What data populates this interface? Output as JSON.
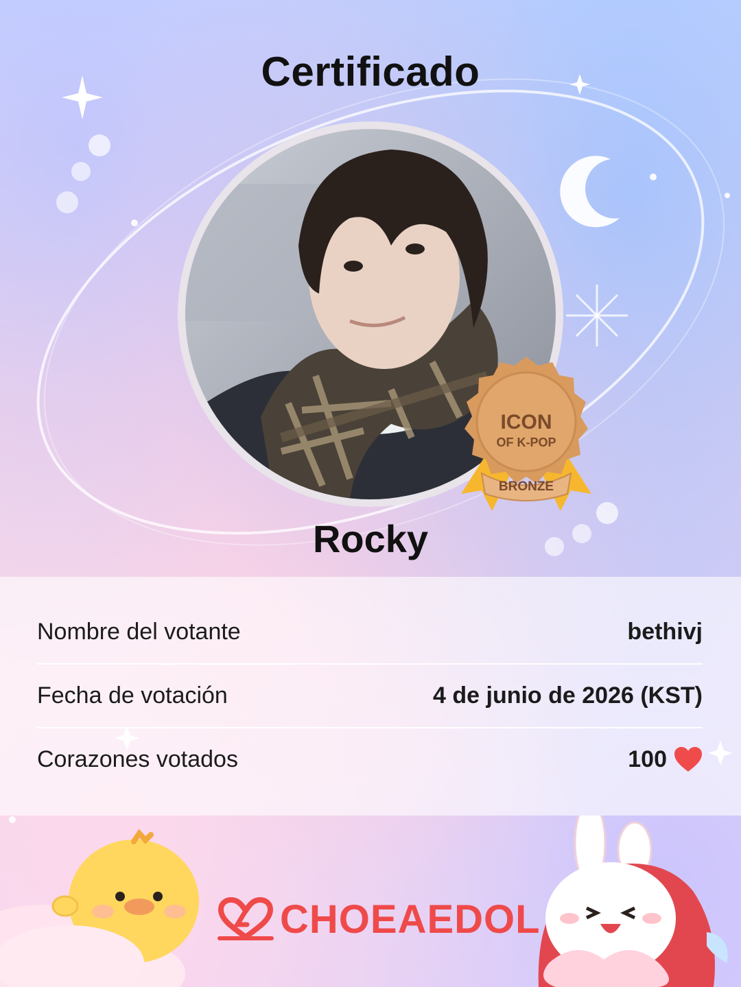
{
  "certificate": {
    "title": "Certificado",
    "idol_name": "Rocky",
    "badge": {
      "line1": "ICON",
      "line2": "OF K-POP",
      "tier": "BRONZE"
    }
  },
  "info_rows": [
    {
      "label": "Nombre del votante",
      "value": "bethivj"
    },
    {
      "label": "Fecha de votación",
      "value": "4 de junio de 2026 (KST)"
    },
    {
      "label": "Corazones votados",
      "value": "100"
    }
  ],
  "brand": {
    "name": "CHOEAEDOL"
  },
  "colors": {
    "brand_red": "#ef4a4a",
    "heart_red": "#f04b4b",
    "badge_bronze": "#d99a5e"
  },
  "icons": [
    "heart-icon",
    "choeaedol-logo-icon",
    "bronze-medal-icon",
    "moon-icon",
    "sparkle-icon"
  ]
}
